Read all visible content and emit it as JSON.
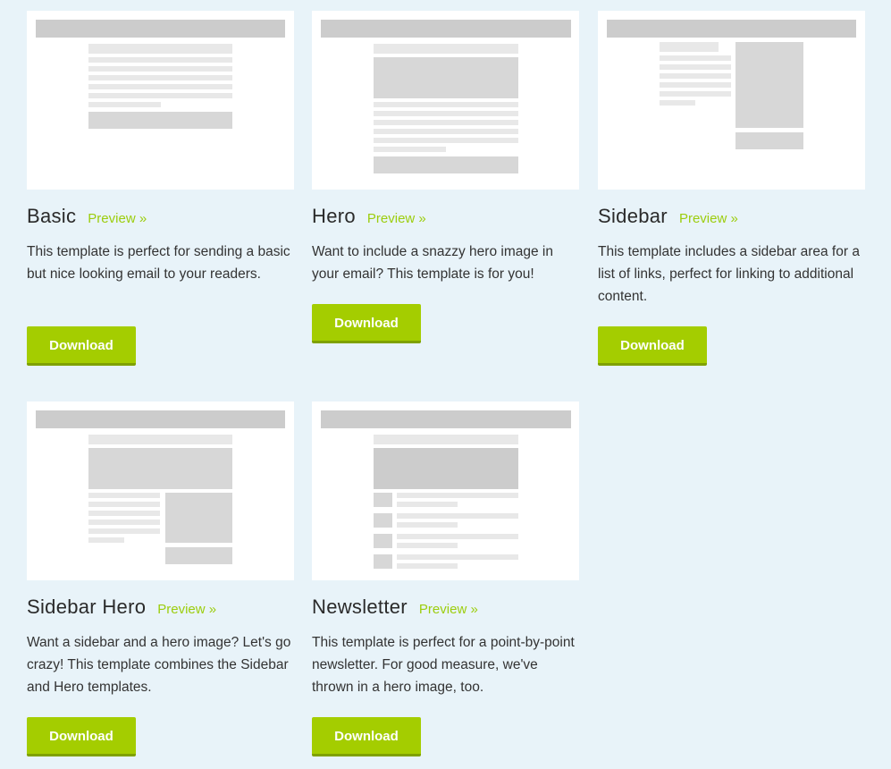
{
  "colors": {
    "background": "#e8f3f9",
    "accent": "#a4cd00",
    "preview_link": "#9ccd0d"
  },
  "templates": [
    {
      "name": "Basic",
      "preview_label": "Preview »",
      "description": "This template is perfect for sending a basic but nice looking email to your readers.",
      "download_label": "Download"
    },
    {
      "name": "Hero",
      "preview_label": "Preview »",
      "description": "Want to include a snazzy hero image in your email? This template is for you!",
      "download_label": "Download"
    },
    {
      "name": "Sidebar",
      "preview_label": "Preview »",
      "description": "This template includes a sidebar area for a list of links, perfect for linking to additional content.",
      "download_label": "Download"
    },
    {
      "name": "Sidebar Hero",
      "preview_label": "Preview »",
      "description": "Want a sidebar and a hero image? Let's go crazy! This template combines the Sidebar and Hero templates.",
      "download_label": "Download"
    },
    {
      "name": "Newsletter",
      "preview_label": "Preview »",
      "description": "This template is perfect for a point-by-point newsletter. For good measure, we've thrown in a hero image, too.",
      "download_label": "Download"
    }
  ]
}
